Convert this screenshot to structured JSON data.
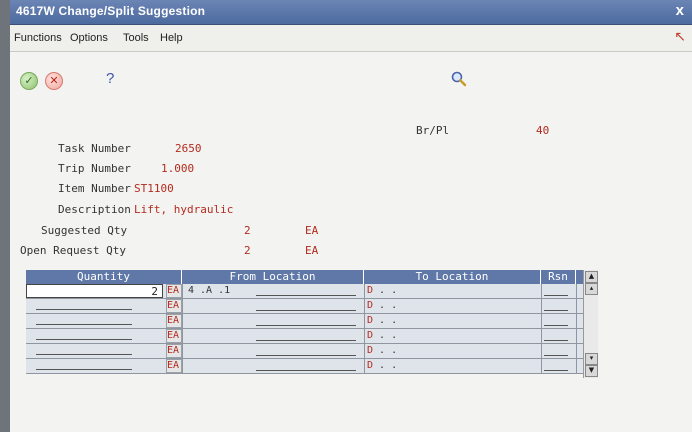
{
  "window": {
    "title": "4617W   Change/Split Suggestion",
    "close_glyph": "x"
  },
  "menu": {
    "items": [
      "Functions",
      "Options",
      "Tools",
      "Help"
    ]
  },
  "toolbar": {
    "ok_icon": "check-icon",
    "cancel_icon": "x-icon",
    "help_glyph": "?",
    "search_icon": "magnifier-icon"
  },
  "form": {
    "br_pl_label": "Br/Pl",
    "br_pl_value": "40",
    "task_number_label": "Task Number",
    "task_number_value": "2650",
    "trip_number_label": "Trip Number",
    "trip_number_value": "1.000",
    "item_number_label": "Item Number",
    "item_number_value": "ST1100",
    "description_label": "Description",
    "description_value": "Lift, hydraulic",
    "suggested_qty_label": "Suggested Qty",
    "suggested_qty_value": "2",
    "suggested_qty_um": "EA",
    "open_request_qty_label": "Open Request Qty",
    "open_request_qty_value": "2",
    "open_request_qty_um": "EA"
  },
  "grid": {
    "headers": [
      "Quantity",
      "From Location",
      "To Location",
      "Rsn"
    ],
    "rows": [
      {
        "quantity": "2",
        "um": "EA",
        "from": "4 .A   .1",
        "to_prefix": "D",
        "to_rest": " .  ."
      },
      {
        "quantity": "",
        "um": "EA",
        "from": "",
        "to_prefix": "D",
        "to_rest": " .  ."
      },
      {
        "quantity": "",
        "um": "EA",
        "from": "",
        "to_prefix": "D",
        "to_rest": " .  ."
      },
      {
        "quantity": "",
        "um": "EA",
        "from": "",
        "to_prefix": "D",
        "to_rest": " .  ."
      },
      {
        "quantity": "",
        "um": "EA",
        "from": "",
        "to_prefix": "D",
        "to_rest": " .  ."
      },
      {
        "quantity": "",
        "um": "EA",
        "from": "",
        "to_prefix": "D",
        "to_rest": " .  ."
      }
    ]
  },
  "colors": {
    "title_bar": "#5570a6",
    "header_bg": "#5f78a8",
    "value_red": "#b32b1f"
  }
}
